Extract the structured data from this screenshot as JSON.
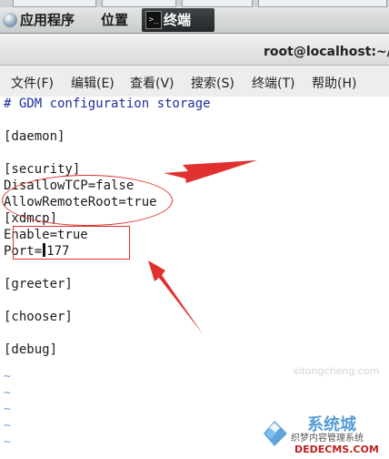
{
  "panel": {
    "applications": "应用程序",
    "places": "位置",
    "terminal": "终端"
  },
  "window": {
    "title": "root@localhost:~/桌"
  },
  "menubar": {
    "file": "文件(F)",
    "edit": "编辑(E)",
    "view": "查看(V)",
    "search": "搜索(S)",
    "terminal": "终端(T)",
    "help": "帮助(H)"
  },
  "editor": {
    "lines": [
      "# GDM configuration storage",
      "",
      "[daemon]",
      "",
      "[security]",
      "DisallowTCP=false",
      "AllowRemoteRoot=true",
      "[xdmcp]",
      "Enable=true",
      "Port=177",
      "",
      "[greeter]",
      "",
      "[chooser]",
      "",
      "[debug]",
      "",
      "~",
      "~",
      "~",
      "~",
      "~"
    ],
    "port_prefix": "Port=",
    "port_suffix": "177"
  },
  "watermark": {
    "site_name": "系统城",
    "subtitle": "织梦内容管理系统",
    "url": "DEDECMS.COM",
    "faint": "xitongcheng.com"
  },
  "colors": {
    "annotation": "#e03030",
    "comment": "#1d2f9e",
    "tilde": "#6f9fd0"
  }
}
